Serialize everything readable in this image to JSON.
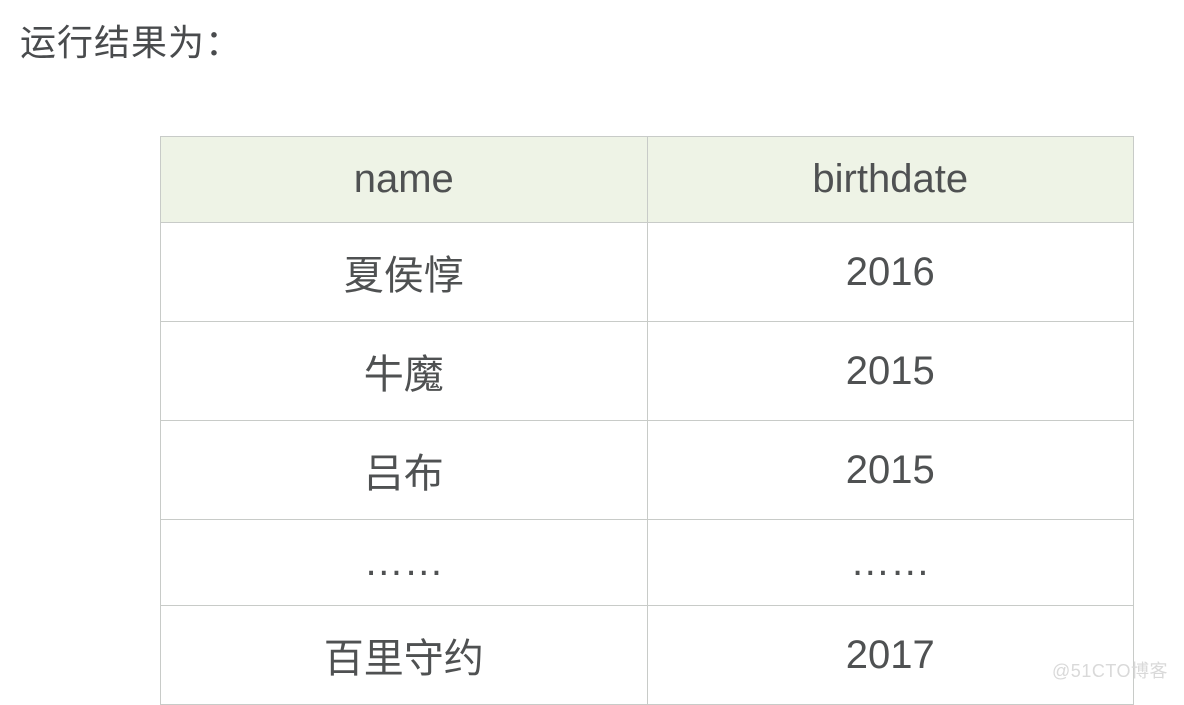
{
  "intro": "运行结果为：",
  "table": {
    "headers": {
      "col1": "name",
      "col2": "birthdate"
    },
    "rows": [
      {
        "name": "夏侯惇",
        "birthdate": "2016"
      },
      {
        "name": "牛魔",
        "birthdate": "2015"
      },
      {
        "name": "吕布",
        "birthdate": "2015"
      },
      {
        "name": "……",
        "birthdate": "……"
      },
      {
        "name": "百里守约",
        "birthdate": "2017"
      }
    ]
  },
  "watermark": "@51CTO博客"
}
